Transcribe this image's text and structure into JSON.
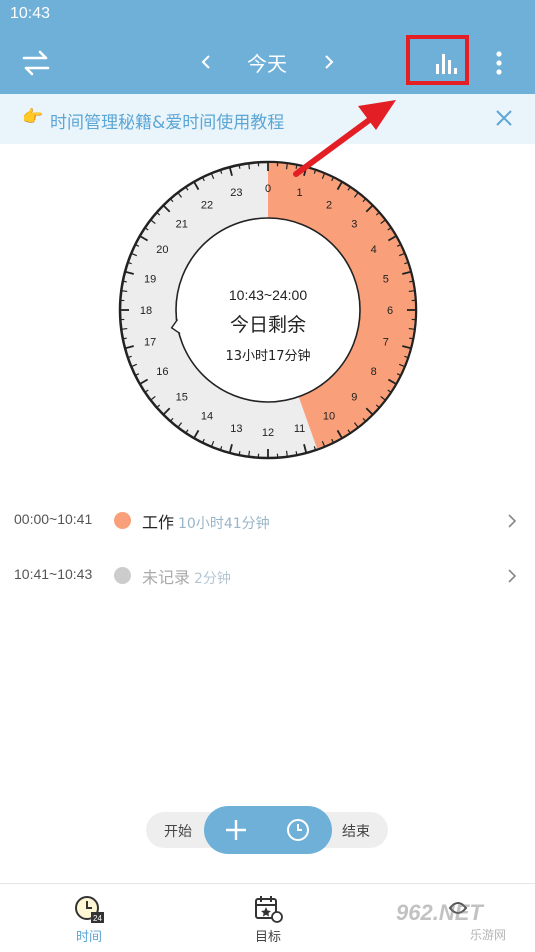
{
  "status_bar": {
    "time": "10:43"
  },
  "app_bar": {
    "title": "今天"
  },
  "tip": {
    "text": "时间管理秘籍&爱时间使用教程"
  },
  "dial": {
    "center_range": "10:43~24:00",
    "center_title": "今日剩余",
    "center_remaining": "13小时17分钟",
    "hour_labels": [
      "0",
      "1",
      "2",
      "3",
      "4",
      "5",
      "6",
      "7",
      "8",
      "9",
      "10",
      "11",
      "12",
      "13",
      "14",
      "15",
      "16",
      "17",
      "18",
      "19",
      "20",
      "21",
      "22",
      "23"
    ],
    "filled_hours": 10.7,
    "colors": {
      "filled": "#f9a07a",
      "empty": "#ededed",
      "ring": "#222222"
    }
  },
  "records": [
    {
      "range": "00:00~10:41",
      "name": "工作",
      "duration": "10小时41分钟",
      "color": "#f9a07a"
    },
    {
      "range": "10:41~10:43",
      "name": "未记录",
      "duration": "2分钟",
      "color": "#cccccc"
    }
  ],
  "controls": {
    "start_label": "开始",
    "end_label": "结束"
  },
  "bottom_nav": {
    "time_label": "时间",
    "goal_label": "目标",
    "time_badge": "24"
  },
  "watermark": {
    "brand": "962.NET",
    "sub": "乐游网"
  },
  "colors": {
    "primary": "#6eb0d8",
    "accent_orange": "#f9a07a",
    "annotation_red": "#e31e24"
  }
}
